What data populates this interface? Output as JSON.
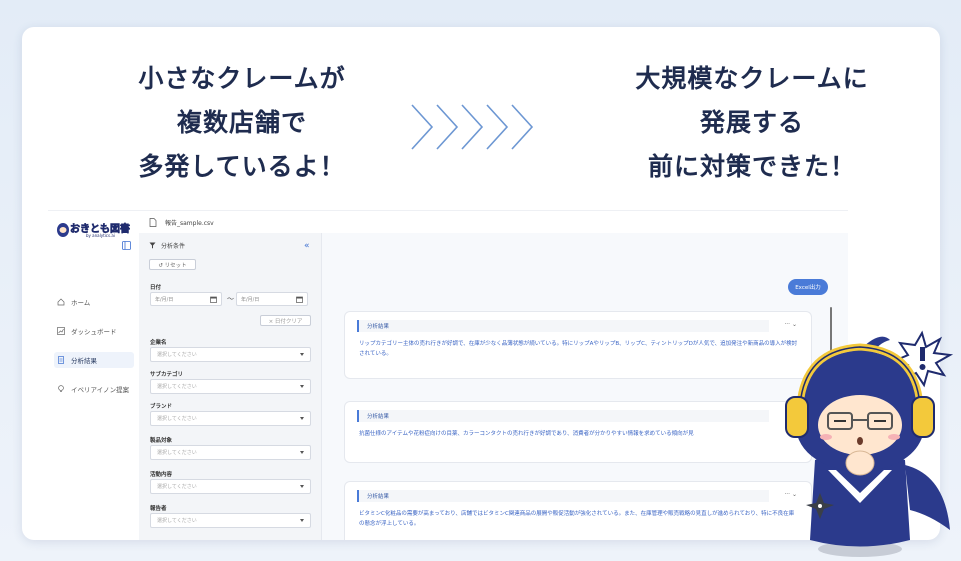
{
  "headline_left": {
    "line1": "小さなクレームが",
    "line2": "複数店舗で",
    "line3": "多発しているよ！"
  },
  "headline_right": {
    "line1": "大規模なクレームに",
    "line2": "発展する",
    "line3": "前に対策できた！"
  },
  "app": {
    "logo": {
      "main": "おきとも図書",
      "sub": "by analytics.ai"
    },
    "file_name": "報告_sample.csv",
    "nav": [
      {
        "label": "ホーム",
        "icon": "home-icon"
      },
      {
        "label": "ダッシュボード",
        "icon": "chart-icon"
      },
      {
        "label": "分析結果",
        "icon": "document-icon"
      },
      {
        "label": "イベリアイノン提案",
        "icon": "lightbulb-icon"
      }
    ],
    "filter": {
      "title": "分析条件",
      "reset": "↺ リセット",
      "date_label": "日付",
      "date_placeholder": "年/月/日",
      "date_separator": "〜",
      "date_clear": "× 日付クリア",
      "fields": [
        {
          "label": "企業名",
          "placeholder": "選択してください"
        },
        {
          "label": "サブカテゴリ",
          "placeholder": "選択してください"
        },
        {
          "label": "ブランド",
          "placeholder": "選択してください"
        },
        {
          "label": "製品対象",
          "placeholder": "選択してください"
        },
        {
          "label": "活動内容",
          "placeholder": "選択してください"
        },
        {
          "label": "報告者",
          "placeholder": "選択してください"
        }
      ]
    },
    "excel_button": "Excel出力",
    "results": [
      {
        "title": "分析結果",
        "text": "リップカテゴリー主体の売れ行きが好調で、在庫が少なく品薄状態が続いている。特にリップAやリップB、リップC、ティントリップDが人気で、追加発注や新商品の導入が検討されている。"
      },
      {
        "title": "分析結果",
        "text": "抗菌仕様のアイテムや花粉症向けの目薬、カラーコンタクトの売れ行きが好調であり、消費者が分かりやすい情報を求めている傾向が見"
      },
      {
        "title": "分析結果",
        "text": "ビタミンC化粧品の需要が高まっており、店舗ではビタミンC関連商品の展開や販促活動が強化されている。また、在庫管理や販売戦略の見直しが進められており、特に不良在庫の懸念が浮上している。"
      }
    ],
    "card_tools": "··· ⌄"
  },
  "colors": {
    "headline": "#1f2c4f",
    "accent": "#4a7bd8",
    "chevron": "#6d97d3",
    "mascot_body": "#2b3a8c",
    "headphones": "#f3c93b"
  }
}
